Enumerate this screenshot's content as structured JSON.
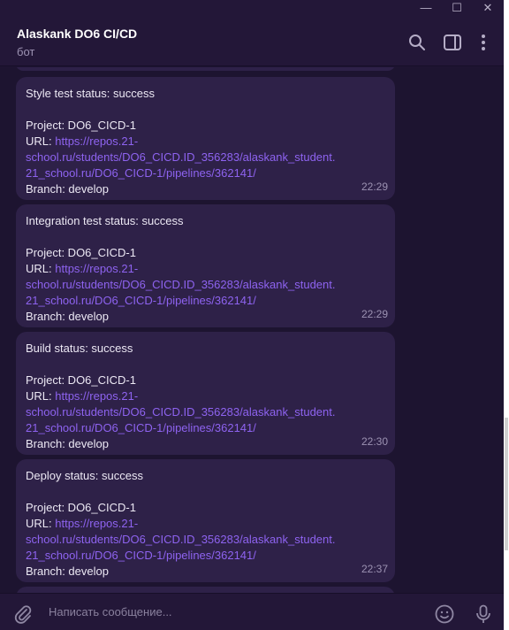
{
  "window": {
    "minimize_glyph": "—",
    "maximize_glyph": "☐",
    "close_glyph": "✕"
  },
  "header": {
    "title": "Alaskank DO6 CI/CD",
    "subtitle": "бот",
    "icons": [
      "search-icon",
      "sidebar-toggle-icon",
      "more-vertical-icon"
    ]
  },
  "messages": [
    {
      "status": "Style test status: success",
      "project": "Project: DO6_CICD-1",
      "url_label": "URL: ",
      "url_lines": [
        "https://repos.21-",
        "school.ru/students/DO6_CICD.ID_356283/alaskank_student.",
        "21_school.ru/DO6_CICD-1/pipelines/362141/"
      ],
      "branch": "Branch: develop",
      "time": "22:29"
    },
    {
      "status": "Integration test status: success",
      "project": "Project: DO6_CICD-1",
      "url_label": "URL: ",
      "url_lines": [
        "https://repos.21-",
        "school.ru/students/DO6_CICD.ID_356283/alaskank_student.",
        "21_school.ru/DO6_CICD-1/pipelines/362141/"
      ],
      "branch": "Branch: develop",
      "time": "22:29"
    },
    {
      "status": "Build status: success",
      "project": "Project: DO6_CICD-1",
      "url_label": "URL: ",
      "url_lines": [
        "https://repos.21-",
        "school.ru/students/DO6_CICD.ID_356283/alaskank_student.",
        "21_school.ru/DO6_CICD-1/pipelines/362141/"
      ],
      "branch": "Branch: develop",
      "time": "22:30"
    },
    {
      "status": "Deploy status: success",
      "project": "Project: DO6_CICD-1",
      "url_label": "URL: ",
      "url_lines": [
        "https://repos.21-",
        "school.ru/students/DO6_CICD.ID_356283/alaskank_student.",
        "21_school.ru/DO6_CICD-1/pipelines/362141/"
      ],
      "branch": "Branch: develop",
      "time": "22:37"
    }
  ],
  "composer": {
    "placeholder": "Написать сообщение...",
    "icons": [
      "attach-icon",
      "emoji-icon",
      "microphone-icon"
    ]
  },
  "colors": {
    "background": "#1d1430",
    "bubble": "#2e2148",
    "link": "#8e63f0",
    "header": "#231738"
  }
}
